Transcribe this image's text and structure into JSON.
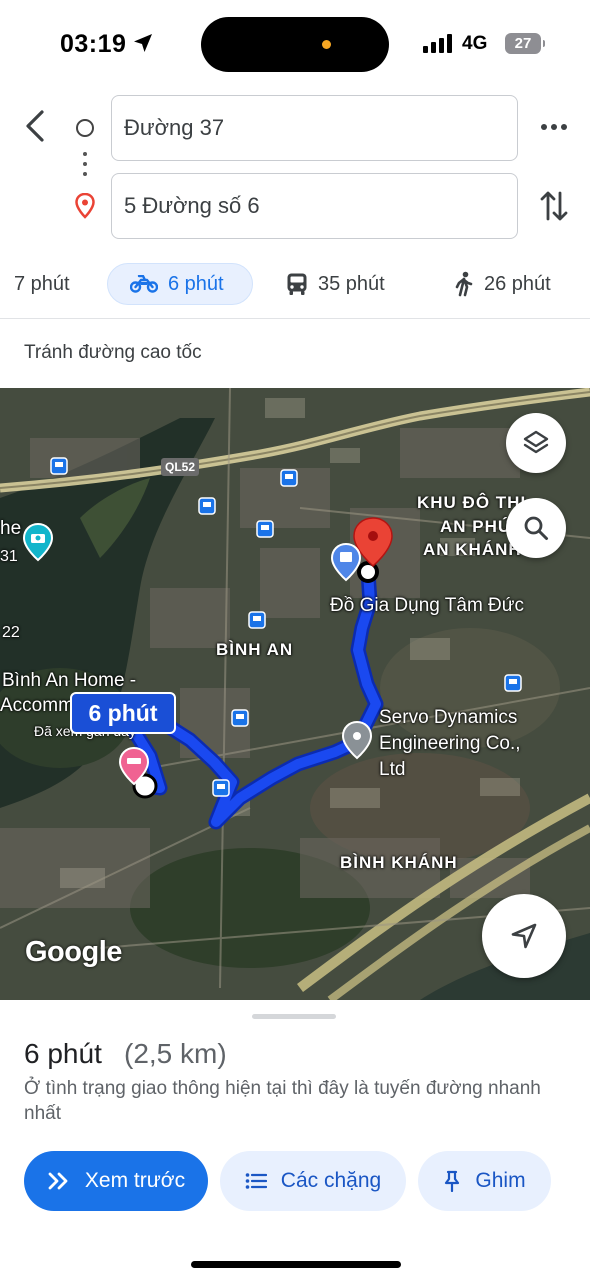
{
  "status_bar": {
    "time": "03:19",
    "network": "4G",
    "battery": "27"
  },
  "route": {
    "origin": "Đường 37",
    "destination": "5 Đường số 6"
  },
  "modes": [
    {
      "label": "7 phút",
      "icon": "car-icon",
      "selected": false
    },
    {
      "label": "6 phút",
      "icon": "motorbike-icon",
      "selected": true
    },
    {
      "label": "35 phút",
      "icon": "transit-icon",
      "selected": false
    },
    {
      "label": "26 phút",
      "icon": "walk-icon",
      "selected": false
    }
  ],
  "route_option": "Tránh đường cao tốc",
  "map": {
    "eta_label": "6 phút",
    "road_badge": "QL52",
    "labels": {
      "area_binh_an": "BÌNH AN",
      "area_binh_khanh": "BÌNH KHÁNH",
      "area_khu_do_thi_1": "KHU ĐÔ THỊ",
      "area_khu_do_thi_2": "AN PHÚ",
      "area_khu_do_thi_3": "AN KHÁNH",
      "poi_tam_duc": "Đồ Gia Dụng Tâm Đức",
      "poi_servo_1": "Servo Dynamics",
      "poi_servo_2": "Engineering Co.,",
      "poi_servo_3": "Ltd",
      "poi_binh_an_home_1": "Bình An Home -",
      "poi_binh_an_home_2": "Accomm",
      "poi_recent": "Đã xem gần đây",
      "edge_he": "he",
      "edge_31": "31",
      "edge_22": "22"
    },
    "attribution": "Google",
    "route_color": "#1a49f0"
  },
  "sheet": {
    "duration": "6 phút",
    "distance": "(2,5 km)",
    "description": "Ở tình trạng giao thông hiện tại thì đây là tuyến đường nhanh nhất",
    "buttons": {
      "preview": "Xem trước",
      "steps": "Các chặng",
      "pin": "Ghim"
    }
  },
  "colors": {
    "accent": "#1a73e8",
    "chip_bg": "#e8f0fe",
    "destination_pin": "#ea4335"
  }
}
